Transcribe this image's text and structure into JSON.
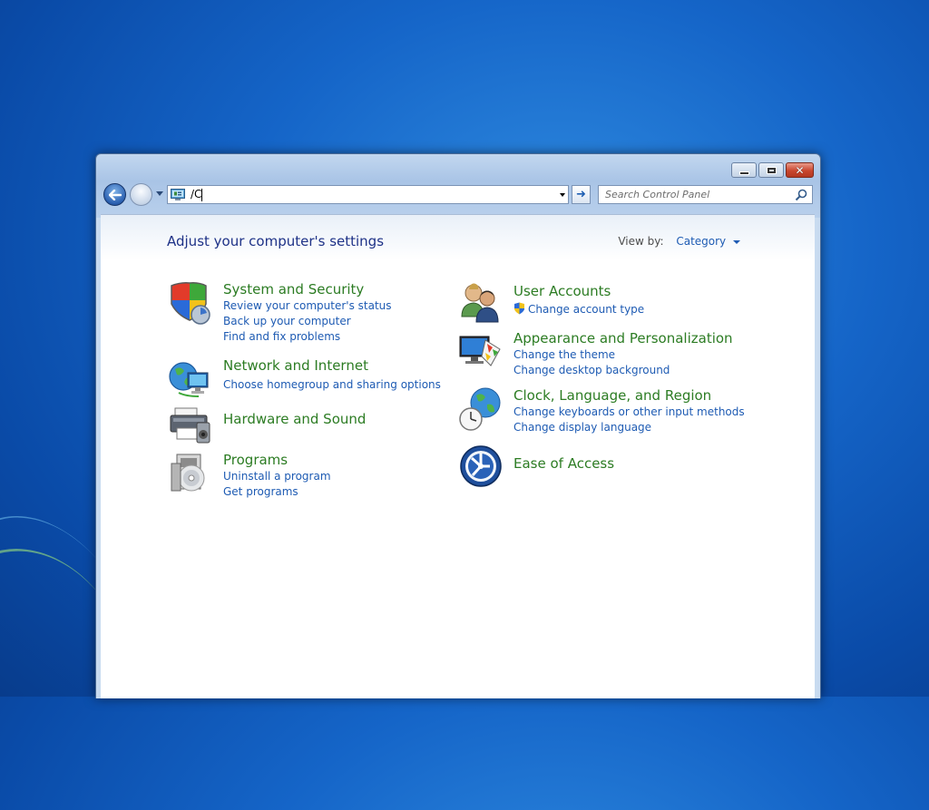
{
  "window": {
    "caption_buttons": {
      "minimize": "minimize",
      "maximize": "maximize",
      "close": "close"
    }
  },
  "nav": {
    "address_value": "/C",
    "search_placeholder": "Search Control Panel"
  },
  "header": {
    "title": "Adjust your computer's settings",
    "view_by_label": "View by:",
    "view_by_value": "Category"
  },
  "categories_left": [
    {
      "title": "System and Security",
      "icon": "shield-icon",
      "links": [
        "Review your computer's status",
        "Back up your computer",
        "Find and fix problems"
      ]
    },
    {
      "title": "Network and Internet",
      "icon": "network-globe-icon",
      "links": [
        "Choose homegroup and sharing options"
      ]
    },
    {
      "title": "Hardware and Sound",
      "icon": "printer-icon",
      "links": []
    },
    {
      "title": "Programs",
      "icon": "programs-disc-icon",
      "links": [
        "Uninstall a program",
        "Get programs"
      ]
    }
  ],
  "categories_right": [
    {
      "title": "User Accounts",
      "icon": "users-icon",
      "links": [
        "Change account type"
      ]
    },
    {
      "title": "Appearance and Personalization",
      "icon": "monitor-palette-icon",
      "links": [
        "Change the theme",
        "Change desktop background"
      ]
    },
    {
      "title": "Clock, Language, and Region",
      "icon": "clock-globe-icon",
      "links": [
        "Change keyboards or other input methods",
        "Change display language"
      ]
    },
    {
      "title": "Ease of Access",
      "icon": "ease-of-access-icon",
      "links": []
    }
  ],
  "colors": {
    "category_title": "#2c7c23",
    "link": "#1e5bb3",
    "page_title": "#1e3287"
  }
}
